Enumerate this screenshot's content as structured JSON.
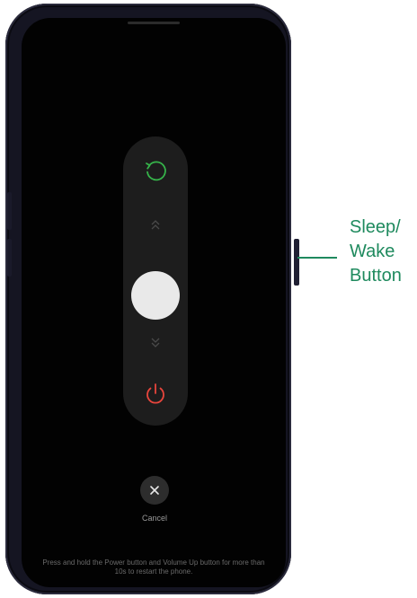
{
  "power_menu": {
    "restart_icon": "restart-icon",
    "power_icon": "power-icon",
    "restart_color": "#36b34a",
    "power_color": "#e8453c"
  },
  "cancel": {
    "icon": "close-icon",
    "label": "Cancel"
  },
  "hint_text": "Press and hold the Power button and Volume Up button for more than 10s to restart the phone.",
  "callout": {
    "label": "Sleep/\nWake\nButton",
    "color": "#1f8a5e"
  }
}
